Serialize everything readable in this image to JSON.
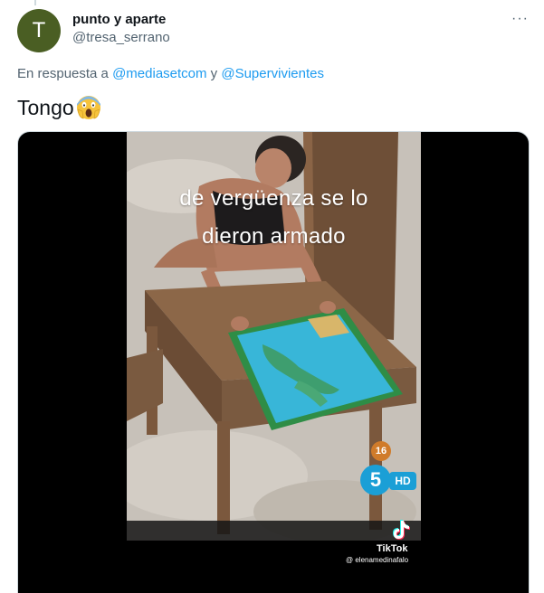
{
  "author": {
    "avatar_letter": "T",
    "avatar_color": "#4a5e23",
    "display_name": "punto y aparte",
    "handle": "@tresa_serrano"
  },
  "more_icon": "more-horizontal-icon",
  "more_glyph": "···",
  "reply": {
    "prefix": "En respuesta a ",
    "mention1": "@mediasetcom",
    "connector": " y ",
    "mention2": "@Supervivientes"
  },
  "tweet": {
    "text": "Tongo",
    "emoji": "screaming-face-emoji"
  },
  "media": {
    "caption_line1": "de vergüenza se lo",
    "caption_line2": "dieron armado",
    "age_rating": "16",
    "channel_logo": "5",
    "hd_label": "HD",
    "tiktok_icon": "tiktok-icon",
    "tiktok_name": "TikTok",
    "tiktok_user": "@ elenamedinafalo"
  },
  "colors": {
    "accent": "#1d9bf0",
    "secondary_text": "#536471",
    "channel_blue": "#1b9fd6"
  }
}
